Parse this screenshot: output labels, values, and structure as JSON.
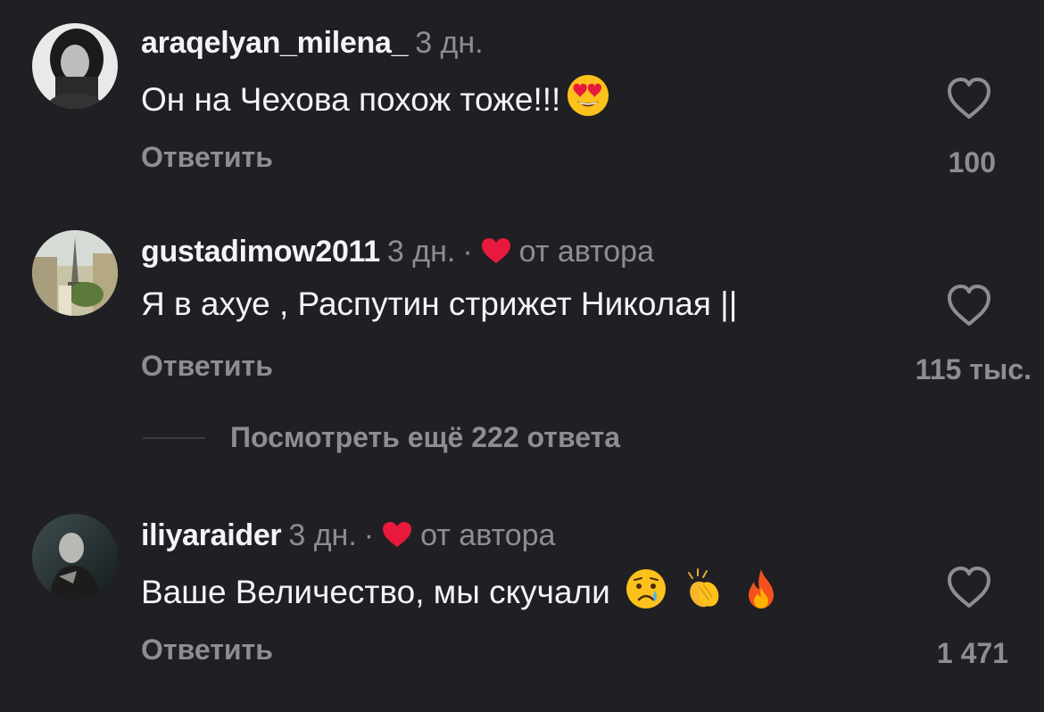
{
  "colors": {
    "background": "#1f1f24",
    "text": "#f4f4f7",
    "secondary_text": "#8d8d96",
    "author_heart": "#e8193c"
  },
  "comments": [
    {
      "username": "araqelyan_milena_",
      "time": "3 дн.",
      "text": "Он на Чехова похож тоже!!!",
      "emojis": [
        "heart-eyes-emoji"
      ],
      "reply_label": "Ответить",
      "likes": "100",
      "liked_by_author": false
    },
    {
      "username": "gustadimow2011",
      "time": "3 дн.",
      "separator": "·",
      "author_label": "от автора",
      "text": "Я в ахуе , Распутин стрижет Николая ||",
      "emojis": [],
      "reply_label": "Ответить",
      "likes": "115 тыс.",
      "liked_by_author": true
    },
    {
      "username": "iliyaraider",
      "time": "3 дн.",
      "separator": "·",
      "author_label": "от автора",
      "text": "Ваше Величество, мы скучали",
      "emojis": [
        "crying-face-emoji",
        "clapping-hands-emoji",
        "fire-emoji"
      ],
      "reply_label": "Ответить",
      "likes": "1 471",
      "liked_by_author": true
    }
  ],
  "view_more": {
    "label": "Посмотреть ещё 222 ответа"
  }
}
